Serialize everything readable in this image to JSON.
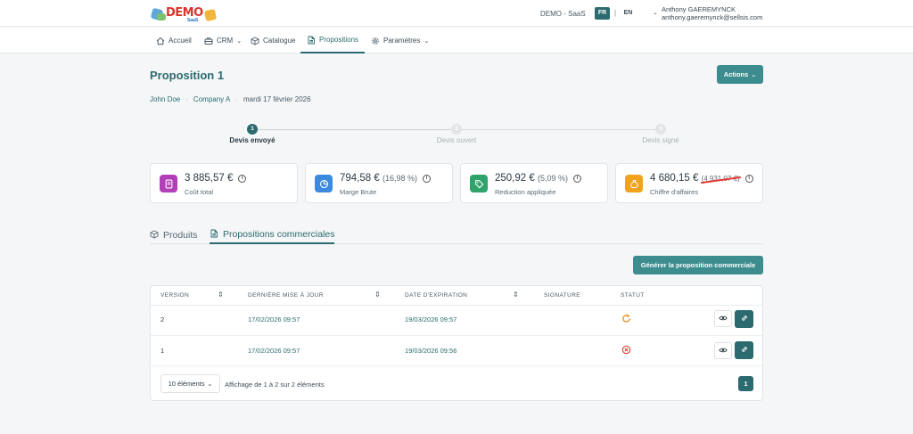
{
  "header": {
    "logo_text": "DEMO",
    "logo_sub": "SaaS",
    "tenant": "DEMO - SaaS",
    "languages": [
      "FR",
      "EN"
    ],
    "language_separator": "|",
    "user_name": "Anthony GAEREMYNCK",
    "user_email": "anthony.gaeremynck@sellsis.com"
  },
  "nav": {
    "items": [
      {
        "label": "Accueil",
        "icon": "home-icon"
      },
      {
        "label": "CRM",
        "icon": "briefcase-icon",
        "dropdown": true
      },
      {
        "label": "Catalogue",
        "icon": "box-icon"
      },
      {
        "label": "Propositions",
        "icon": "document-icon",
        "active": true
      },
      {
        "label": "Paramètres",
        "icon": "gear-icon",
        "dropdown": true
      }
    ]
  },
  "page": {
    "title": "Proposition 1",
    "actions_label": "Actions",
    "breadcrumb": {
      "contact": "John Doe",
      "company": "Company A",
      "date": "mardi 17 février 2026"
    }
  },
  "stepper": [
    {
      "num": "1",
      "label": "Devis envoyé",
      "active": true
    },
    {
      "num": "2",
      "label": "Devis ouvert",
      "active": false
    },
    {
      "num": "3",
      "label": "Devis signé",
      "active": false
    }
  ],
  "kpis": [
    {
      "value": "3 885,57 €",
      "label": "Coût total",
      "color": "#b23fb8",
      "icon": "document-icon"
    },
    {
      "value": "794,58 €",
      "extra": "(16,98 %)",
      "label": "Marge Brute",
      "color": "#3b8ae0",
      "icon": "pie-chart-icon"
    },
    {
      "value": "250,92 €",
      "extra": "(5,09 %)",
      "label": "Reduction appliquée",
      "color": "#2ea36a",
      "icon": "tag-icon"
    },
    {
      "value": "4 680,15 €",
      "strike": "(4 931,07 €)",
      "label": "Chiffre d'affaires",
      "color": "#f2a21d",
      "icon": "money-bag-icon"
    }
  ],
  "tabs": [
    {
      "label": "Produits",
      "active": false
    },
    {
      "label": "Propositions commerciales",
      "active": true
    }
  ],
  "generate_button": "Générer la proposition commerciale",
  "table": {
    "headers": [
      "VERSION",
      "DERNIÈRE MISE À JOUR",
      "DATE D'EXPIRATION",
      "SIGNATURE",
      "STATUT"
    ],
    "rows": [
      {
        "version": "2",
        "updated": "17/02/2026 09:57",
        "expires": "19/03/2026 09:57",
        "signature": "",
        "status": "pending"
      },
      {
        "version": "1",
        "updated": "17/02/2026 09:57",
        "expires": "19/03/2026 09:56",
        "signature": "",
        "status": "cancelled"
      }
    ],
    "page_size": "10 éléments",
    "page_info": "Affichage de 1 à 2 sur 2 éléments",
    "current_page": "1"
  },
  "colors": {
    "primary": "#2b6b6f",
    "button": "#3d8d8f",
    "pending": "#f08a24",
    "cancelled": "#e53935"
  }
}
